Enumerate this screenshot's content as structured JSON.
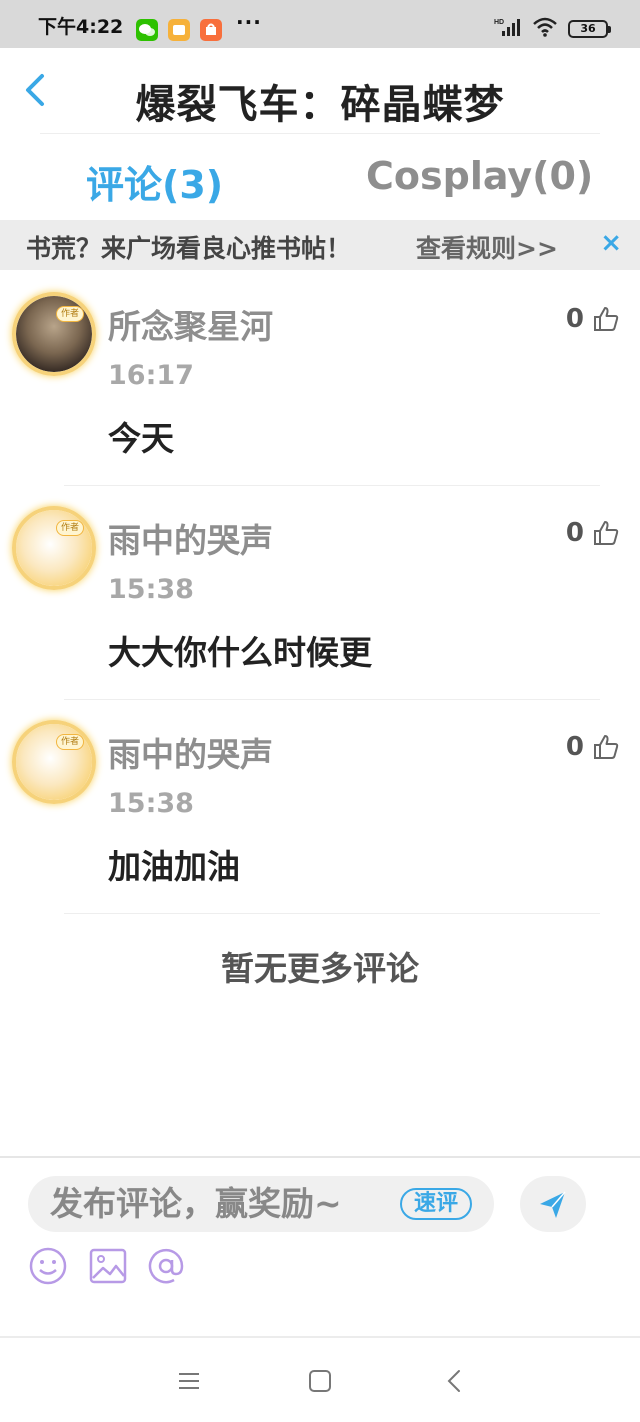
{
  "status_bar": {
    "time": "下午4:22",
    "more": "···",
    "battery": "36",
    "signal_label": "HD",
    "app_icons": [
      "wechat-icon",
      "notes-icon",
      "mi-store-icon"
    ]
  },
  "header": {
    "title": "爆裂飞车：碎晶蝶梦",
    "back_icon": "chevron-left-icon"
  },
  "tabs": [
    {
      "label": "评论(3)",
      "active": true
    },
    {
      "label": "Cosplay(0)",
      "active": false
    }
  ],
  "banner": {
    "text": "书荒？来广场看良心推书帖！",
    "link": "查看规则>>",
    "close": "×"
  },
  "comments": [
    {
      "username": "所念聚星河",
      "time": "16:17",
      "content": "今天",
      "likes": "0",
      "badge": "作者"
    },
    {
      "username": "雨中的哭声",
      "time": "15:38",
      "content": "大大你什么时候更",
      "likes": "0",
      "badge": "作者"
    },
    {
      "username": "雨中的哭声",
      "time": "15:38",
      "content": "加油加油",
      "likes": "0",
      "badge": "作者"
    }
  ],
  "footer_note": "暂无更多评论",
  "composer": {
    "placeholder": "发布评论，赢奖励~",
    "quick_label": "速评",
    "tools": [
      "emoji-icon",
      "image-icon",
      "mention-icon"
    ]
  },
  "colors": {
    "accent": "#3aa8e6",
    "muted_text": "#8e8e8e",
    "banner_bg": "#ececec",
    "status_bar_bg": "#d9d9d9"
  }
}
